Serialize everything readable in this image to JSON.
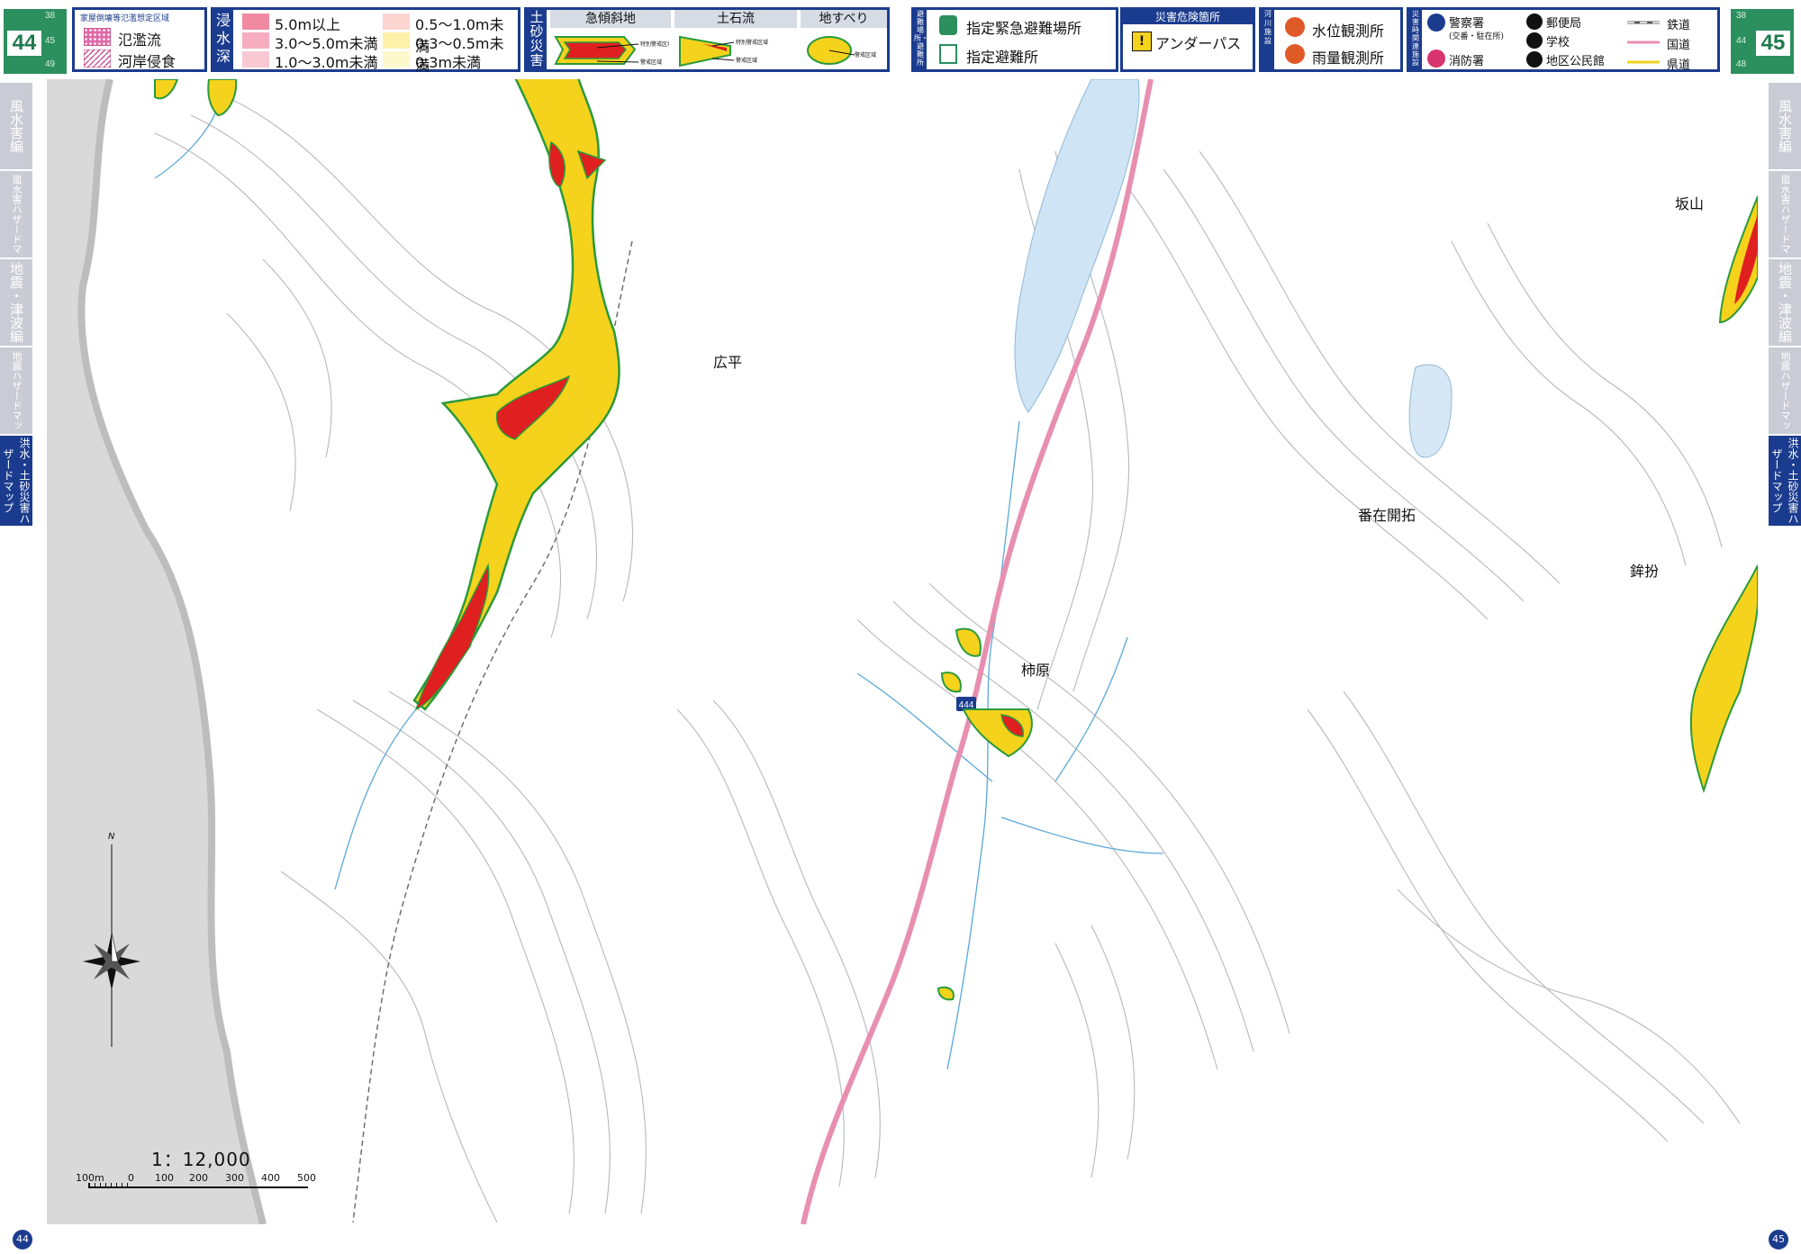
{
  "pages": {
    "left": "44",
    "right": "45"
  },
  "page_index_left": {
    "main": "44",
    "grid": [
      "38",
      "39",
      "44",
      "45",
      "48",
      "49"
    ]
  },
  "page_index_right": {
    "main": "45",
    "grid": [
      "38",
      "39",
      "44",
      "45",
      "48",
      "49"
    ]
  },
  "legend_flood_area": {
    "title": "家屋倒壊等氾濫想定区域",
    "items": [
      "氾濫流",
      "河岸侵食"
    ]
  },
  "legend_inundation": {
    "head": "浸水深",
    "items": [
      "5.0m以上",
      "3.0～5.0m未満",
      "1.0～3.0m未満",
      "0.5～1.0m未満",
      "0.3～0.5m未満",
      "0.3m未満"
    ],
    "colors": [
      "#f08aa2",
      "#f6adbf",
      "#f9c8d3",
      "#fcd4d0",
      "#fdf0a8",
      "#fdf8cc"
    ]
  },
  "legend_sediment": {
    "head": "土砂災害",
    "cols": [
      "急傾斜地",
      "土石流",
      "地すべり"
    ],
    "special_zone": "特別警戒区域",
    "zone": "警戒区域"
  },
  "legend_shelter": {
    "head": "避難場所・避難所",
    "items": [
      "指定緊急避難場所",
      "指定避難所"
    ]
  },
  "legend_danger": {
    "head": "災害危険箇所",
    "items": [
      "アンダーパス"
    ]
  },
  "legend_river": {
    "head": "河川施設",
    "items": [
      "水位観測所",
      "雨量観測所"
    ]
  },
  "legend_facility": {
    "head": "災害時関連施設",
    "items": [
      "警察署",
      "(交番・駐在所)",
      "消防署",
      "郵便局",
      "学校",
      "地区公民館"
    ],
    "lines": [
      "鉄道",
      "国道",
      "県道"
    ]
  },
  "side_tabs_left": [
    "風水害編",
    "風水害ハザードマップ",
    "地震・津波編",
    "地震ハザードマップ",
    "洪水・土砂災害ハザードマップ"
  ],
  "side_tabs_right": [
    "風水害編",
    "風水害ハザードマップ",
    "地震・津波編",
    "地震ハザードマップ",
    "洪水・土砂災害ハザードマップ"
  ],
  "place_names": [
    "広平",
    "柿原",
    "番在開拓",
    "坂山",
    "鉾扮"
  ],
  "route_number": "444",
  "scale": {
    "ratio": "1：12,000",
    "ticks": [
      "100m",
      "0",
      "100",
      "200",
      "300",
      "400",
      "500"
    ]
  },
  "north": "N",
  "colors": {
    "navy": "#1b3c8e",
    "green": "#2b8f5e",
    "danger_red": "#e02020",
    "zone_yellow": "#f5d21c",
    "national_road": "#e88fb0",
    "water": "#cfe4f4",
    "contour": "#b8b8b8"
  }
}
